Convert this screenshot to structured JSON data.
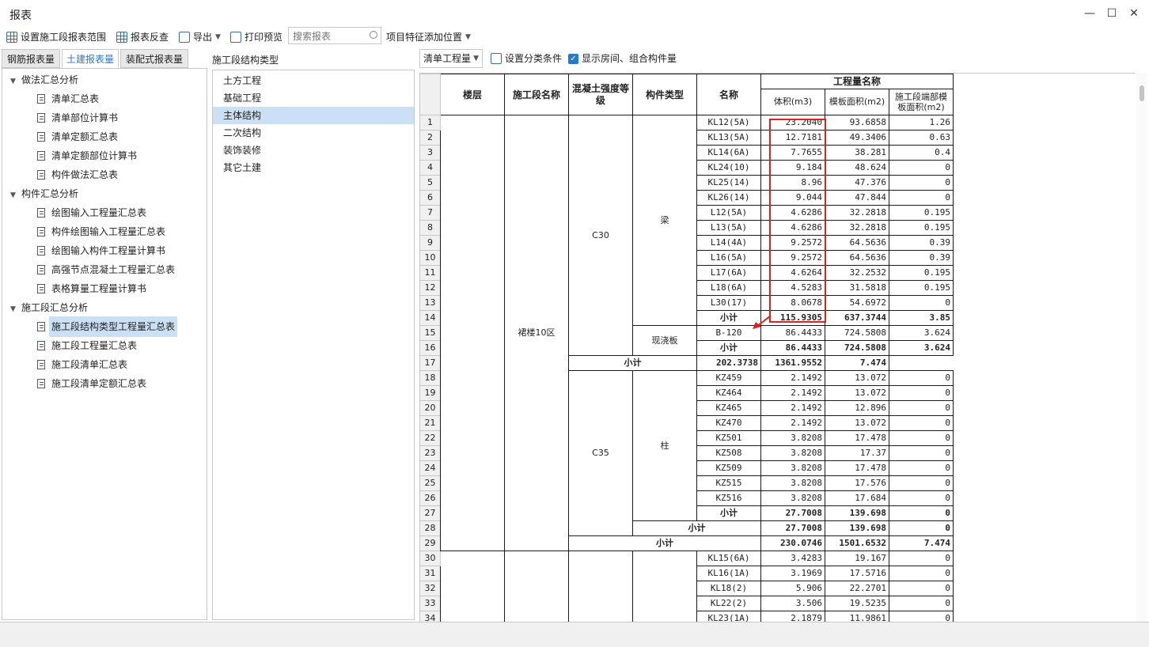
{
  "window": {
    "title": "报表",
    "minimize": "—",
    "maximize": "☐",
    "close": "✕"
  },
  "toolbar": {
    "set_range": "设置施工段报表范围",
    "reverse": "报表反查",
    "export": "导出",
    "print_preview": "打印预览",
    "search_placeholder": "搜索报表",
    "add_feature": "项目特征添加位置"
  },
  "tabs": [
    {
      "label": "钢筋报表量",
      "active": false
    },
    {
      "label": "土建报表量",
      "active": true
    },
    {
      "label": "装配式报表量",
      "active": false
    }
  ],
  "tree": [
    {
      "label": "做法汇总分析",
      "children": [
        "清单汇总表",
        "清单部位计算书",
        "清单定额汇总表",
        "清单定额部位计算书",
        "构件做法汇总表"
      ]
    },
    {
      "label": "构件汇总分析",
      "children": [
        "绘图输入工程量汇总表",
        "构件绘图输入工程量汇总表",
        "绘图输入构件工程量计算书",
        "高强节点混凝土工程量汇总表",
        "表格算量工程量计算书"
      ]
    },
    {
      "label": "施工段汇总分析",
      "children": [
        "施工段结构类型工程量汇总表",
        "施工段工程量汇总表",
        "施工段清单汇总表",
        "施工段清单定额汇总表"
      ]
    }
  ],
  "selected_report": "施工段结构类型工程量汇总表",
  "middle": {
    "title": "施工段结构类型",
    "items": [
      "土方工程",
      "基础工程",
      "主体结构",
      "二次结构",
      "装饰装修",
      "其它土建"
    ],
    "selected": "主体结构"
  },
  "right_toolbar": {
    "quantity_select": "清单工程量",
    "set_classify": "设置分类条件",
    "show_rooms": "显示房间、组合构件量",
    "show_rooms_checked": true
  },
  "table": {
    "headers": {
      "floor": "楼层",
      "segment": "施工段名称",
      "grade": "混凝土强度等级",
      "type": "构件类型",
      "name": "名称",
      "qty": "工程量名称",
      "vol": "体积(m3)",
      "form": "模板面积(m2)",
      "end": "施工段端部模板面积(m2)"
    },
    "segment_value": "裙楼10区",
    "grade_c30": "C30",
    "grade_c35": "C35",
    "type_beam": "梁",
    "type_slab": "现浇板",
    "type_col": "柱",
    "subtotal": "小计",
    "rows": [
      {
        "name": "KL12(5A)",
        "v": "23.2040",
        "f": "93.6858",
        "e": "1.26"
      },
      {
        "name": "KL13(5A)",
        "v": "12.7181",
        "f": "49.3406",
        "e": "0.63"
      },
      {
        "name": "KL14(6A)",
        "v": "7.7655",
        "f": "38.281",
        "e": "0.4"
      },
      {
        "name": "KL24(10)",
        "v": "9.184",
        "f": "48.624",
        "e": "0"
      },
      {
        "name": "KL25(14)",
        "v": "8.96",
        "f": "47.376",
        "e": "0"
      },
      {
        "name": "KL26(14)",
        "v": "9.044",
        "f": "47.844",
        "e": "0"
      },
      {
        "name": "L12(5A)",
        "v": "4.6286",
        "f": "32.2818",
        "e": "0.195"
      },
      {
        "name": "L13(5A)",
        "v": "4.6286",
        "f": "32.2818",
        "e": "0.195"
      },
      {
        "name": "L14(4A)",
        "v": "9.2572",
        "f": "64.5636",
        "e": "0.39"
      },
      {
        "name": "L16(5A)",
        "v": "9.2572",
        "f": "64.5636",
        "e": "0.39"
      },
      {
        "name": "L17(6A)",
        "v": "4.6264",
        "f": "32.2532",
        "e": "0.195"
      },
      {
        "name": "L18(6A)",
        "v": "4.5283",
        "f": "31.5818",
        "e": "0.195"
      },
      {
        "name": "L30(17)",
        "v": "8.0678",
        "f": "54.6972",
        "e": "0"
      },
      {
        "name": "小计",
        "v": "115.9305",
        "f": "637.3744",
        "e": "3.85"
      },
      {
        "name": "B-120",
        "v": "86.4433",
        "f": "724.5808",
        "e": "3.624"
      },
      {
        "name": "小计",
        "v": "86.4433",
        "f": "724.5808",
        "e": "3.624"
      },
      {
        "name": "小计",
        "v": "202.3738",
        "f": "1361.9552",
        "e": "7.474"
      },
      {
        "name": "KZ459",
        "v": "2.1492",
        "f": "13.072",
        "e": "0"
      },
      {
        "name": "KZ464",
        "v": "2.1492",
        "f": "13.072",
        "e": "0"
      },
      {
        "name": "KZ465",
        "v": "2.1492",
        "f": "12.896",
        "e": "0"
      },
      {
        "name": "KZ470",
        "v": "2.1492",
        "f": "13.072",
        "e": "0"
      },
      {
        "name": "KZ501",
        "v": "3.8208",
        "f": "17.478",
        "e": "0"
      },
      {
        "name": "KZ508",
        "v": "3.8208",
        "f": "17.37",
        "e": "0"
      },
      {
        "name": "KZ509",
        "v": "3.8208",
        "f": "17.478",
        "e": "0"
      },
      {
        "name": "KZ515",
        "v": "3.8208",
        "f": "17.576",
        "e": "0"
      },
      {
        "name": "KZ516",
        "v": "3.8208",
        "f": "17.684",
        "e": "0"
      },
      {
        "name": "小计",
        "v": "27.7008",
        "f": "139.698",
        "e": "0"
      },
      {
        "name": "小计",
        "v": "27.7008",
        "f": "139.698",
        "e": "0"
      },
      {
        "name": "小计",
        "v": "230.0746",
        "f": "1501.6532",
        "e": "7.474"
      },
      {
        "name": "KL15(6A)",
        "v": "3.4283",
        "f": "19.167",
        "e": "0"
      },
      {
        "name": "KL16(1A)",
        "v": "3.1969",
        "f": "17.5716",
        "e": "0"
      },
      {
        "name": "KL18(2)",
        "v": "5.906",
        "f": "22.2701",
        "e": "0"
      },
      {
        "name": "KL22(2)",
        "v": "3.506",
        "f": "19.5235",
        "e": "0"
      },
      {
        "name": "KL23(1A)",
        "v": "2.1879",
        "f": "11.9861",
        "e": "0"
      }
    ]
  },
  "colors": {
    "accent": "#2a78c8",
    "selection": "#cce0f5",
    "annotation": "#e02020"
  }
}
